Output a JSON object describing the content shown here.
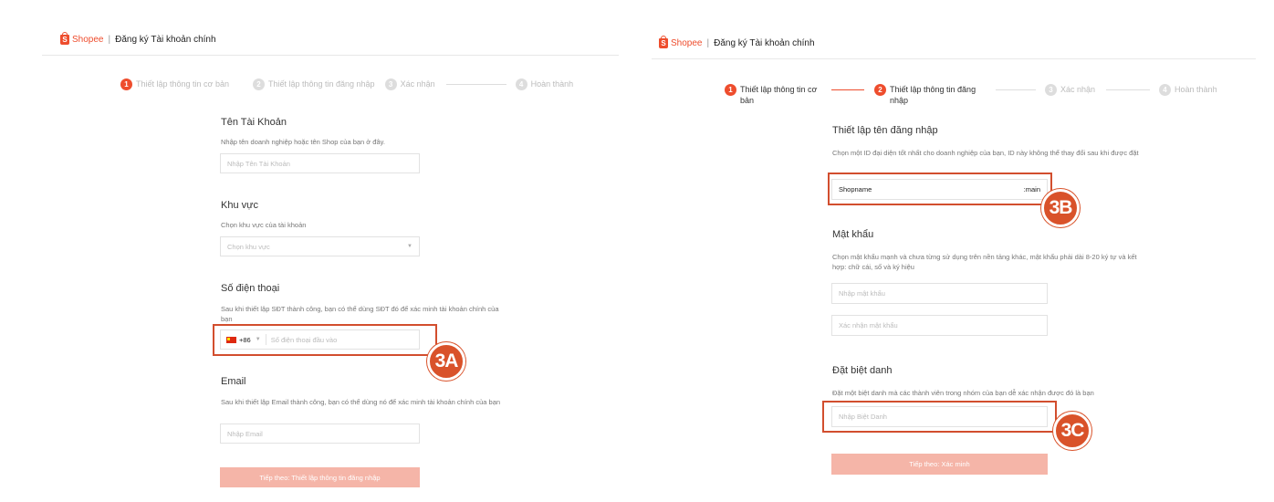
{
  "left": {
    "header": {
      "brand": "Shopee",
      "separator": "|",
      "title": "Đăng ký Tài khoản chính"
    },
    "steps": [
      {
        "num": "1",
        "label": "Thiết lập thông tin cơ bản",
        "active": true
      },
      {
        "num": "2",
        "label": "Thiết lập thông tin đăng nhập",
        "active": false
      },
      {
        "num": "3",
        "label": "Xác nhận",
        "active": false
      },
      {
        "num": "4",
        "label": "Hoàn thành",
        "active": false
      }
    ],
    "account": {
      "title": "Tên Tài Khoản",
      "desc": "Nhập tên doanh nghiệp hoặc tên Shop của bạn ở đây.",
      "placeholder": "Nhập Tên Tài Khoản"
    },
    "region": {
      "title": "Khu vực",
      "desc": "Chọn khu vực của tài khoản",
      "placeholder": "Chọn khu vực"
    },
    "phone": {
      "title": "Số điện thoại",
      "desc": "Sau khi thiết lập SĐT thành công, bạn có thể dùng SĐT đó để xác minh tài khoản chính của bạn",
      "country_code": "+86",
      "placeholder": "Số điện thoại đầu vào"
    },
    "email": {
      "title": "Email",
      "desc": "Sau khi thiết lập Email thành công, bạn có thể dùng nó để xác minh tài khoản chính của bạn",
      "placeholder": "Nhập Email"
    },
    "next_button": "Tiếp theo: Thiết lập thông tin đăng nhập",
    "badge": "3A"
  },
  "right": {
    "header": {
      "brand": "Shopee",
      "separator": "|",
      "title": "Đăng ký Tài khoản chính"
    },
    "steps": [
      {
        "num": "1",
        "label": "Thiết lập thông tin cơ bản",
        "state": "done"
      },
      {
        "num": "2",
        "label": "Thiết lập thông tin đăng nhập",
        "state": "active"
      },
      {
        "num": "3",
        "label": "Xác nhận",
        "state": "pending"
      },
      {
        "num": "4",
        "label": "Hoàn thành",
        "state": "pending"
      }
    ],
    "login": {
      "title": "Thiết lập tên đăng nhập",
      "desc": "Chọn một ID đại diện tốt nhất cho doanh nghiệp của bạn, ID này không thể thay đổi sau khi được đặt",
      "value": "Shopname",
      "suffix": ":main"
    },
    "password": {
      "title": "Mật khẩu",
      "desc": "Chọn mật khẩu mạnh và chưa từng sử dụng trên nền tảng khác, mật khẩu phải dài 8-20 ký tự và kết hợp: chữ cái, số và ký hiệu",
      "placeholder": "Nhập mật khẩu",
      "confirm_placeholder": "Xác nhận mật khẩu"
    },
    "nickname": {
      "title": "Đặt biệt danh",
      "desc": "Đặt một biệt danh mà các thành viên trong nhóm của bạn dễ xác nhận được đó là bạn",
      "placeholder": "Nhập Biệt Danh"
    },
    "next_button": "Tiếp theo: Xác minh",
    "badge_login": "3B",
    "badge_nickname": "3C"
  },
  "colors": {
    "brand": "#ee4d2d",
    "button_disabled": "#f5b5a8",
    "highlight": "#d24e2e"
  }
}
